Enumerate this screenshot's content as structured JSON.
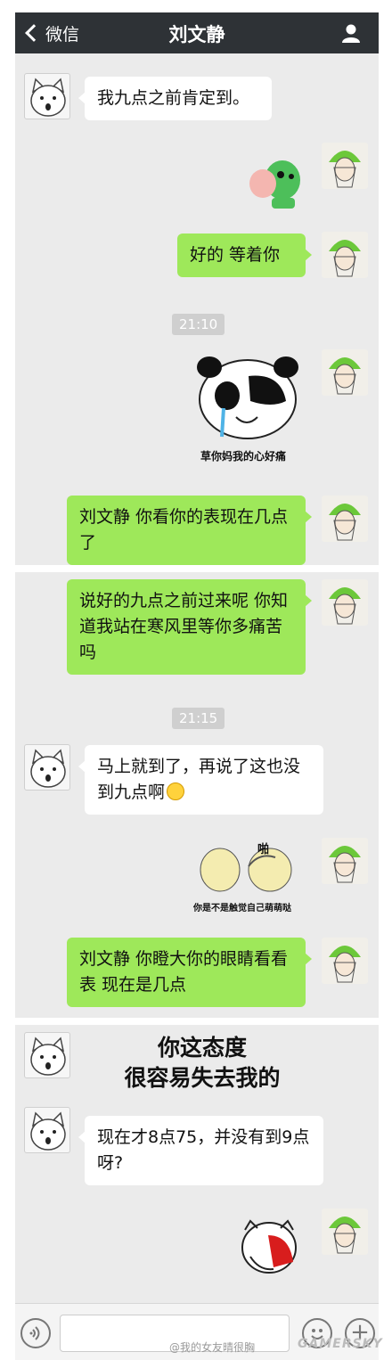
{
  "navbar": {
    "back_label": "微信",
    "title": "刘文静"
  },
  "panel1": {
    "messages": [
      {
        "text": "我九点之前肯定到。"
      },
      {
        "text": "好的  等着你"
      },
      {
        "text": "刘文静  你看你的表现在几点了"
      }
    ],
    "time": "21:10",
    "panda_caption": "草你妈我的心好痛"
  },
  "panel2": {
    "messages": [
      {
        "text": "说好的九点之前过来呢  你知道我站在寒风里等你多痛苦吗"
      },
      {
        "text": "马上就到了，再说了这也没到九点啊"
      },
      {
        "text": "刘文静   你瞪大你的眼睛看看表  现在是几点"
      }
    ],
    "time": "21:15",
    "meme_top": "啪",
    "meme_caption": "你是不是触觉自己萌萌哒"
  },
  "panel3": {
    "big_text_line1": "你这态度",
    "big_text_line2": "很容易失去我的",
    "messages": [
      {
        "text": "现在才8点75，并没有到9点呀?"
      }
    ]
  },
  "footer": {
    "watermark": "@我的女友晴很胸",
    "site_logo": "GAMERSKY"
  },
  "icons": [
    "chevron-left-icon",
    "user-icon",
    "voice-icon",
    "emoji-icon",
    "plus-icon",
    "smile-emoji-icon"
  ]
}
